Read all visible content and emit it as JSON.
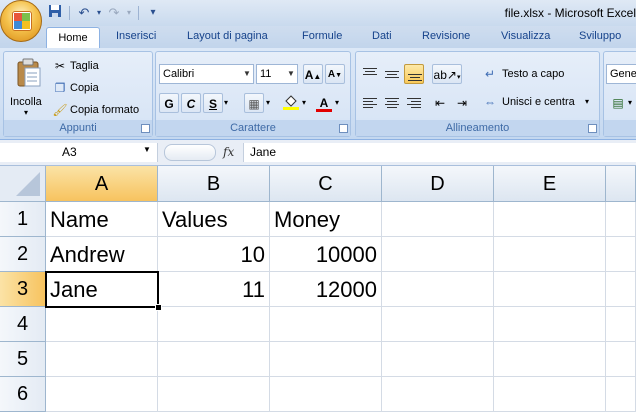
{
  "window": {
    "title": "file.xlsx - Microsoft Excel"
  },
  "ribbon": {
    "tabs": [
      "Home",
      "Inserisci",
      "Layout di pagina",
      "Formule",
      "Dati",
      "Revisione",
      "Visualizza",
      "Sviluppo"
    ],
    "clipboard": {
      "paste": "Incolla",
      "cut": "Taglia",
      "copy": "Copia",
      "format_painter": "Copia formato",
      "group": "Appunti"
    },
    "font": {
      "name": "Calibri",
      "size": "11",
      "bold": "G",
      "italic": "C",
      "underline": "S",
      "group": "Carattere"
    },
    "alignment": {
      "wrap": "Testo a capo",
      "merge": "Unisci e centra",
      "group": "Allineamento"
    },
    "number": {
      "format": "Gene"
    }
  },
  "formula_bar": {
    "name_box": "A3",
    "fx": "fx",
    "content": "Jane"
  },
  "sheet": {
    "columns": [
      "A",
      "B",
      "C",
      "D",
      "E"
    ],
    "rows": [
      "1",
      "2",
      "3",
      "4",
      "5",
      "6"
    ],
    "cells": [
      [
        "Name",
        "Values",
        "Money"
      ],
      [
        "Andrew",
        "10",
        "10000"
      ],
      [
        "Jane",
        "11",
        "12000"
      ]
    ],
    "active_cell": "A3"
  }
}
